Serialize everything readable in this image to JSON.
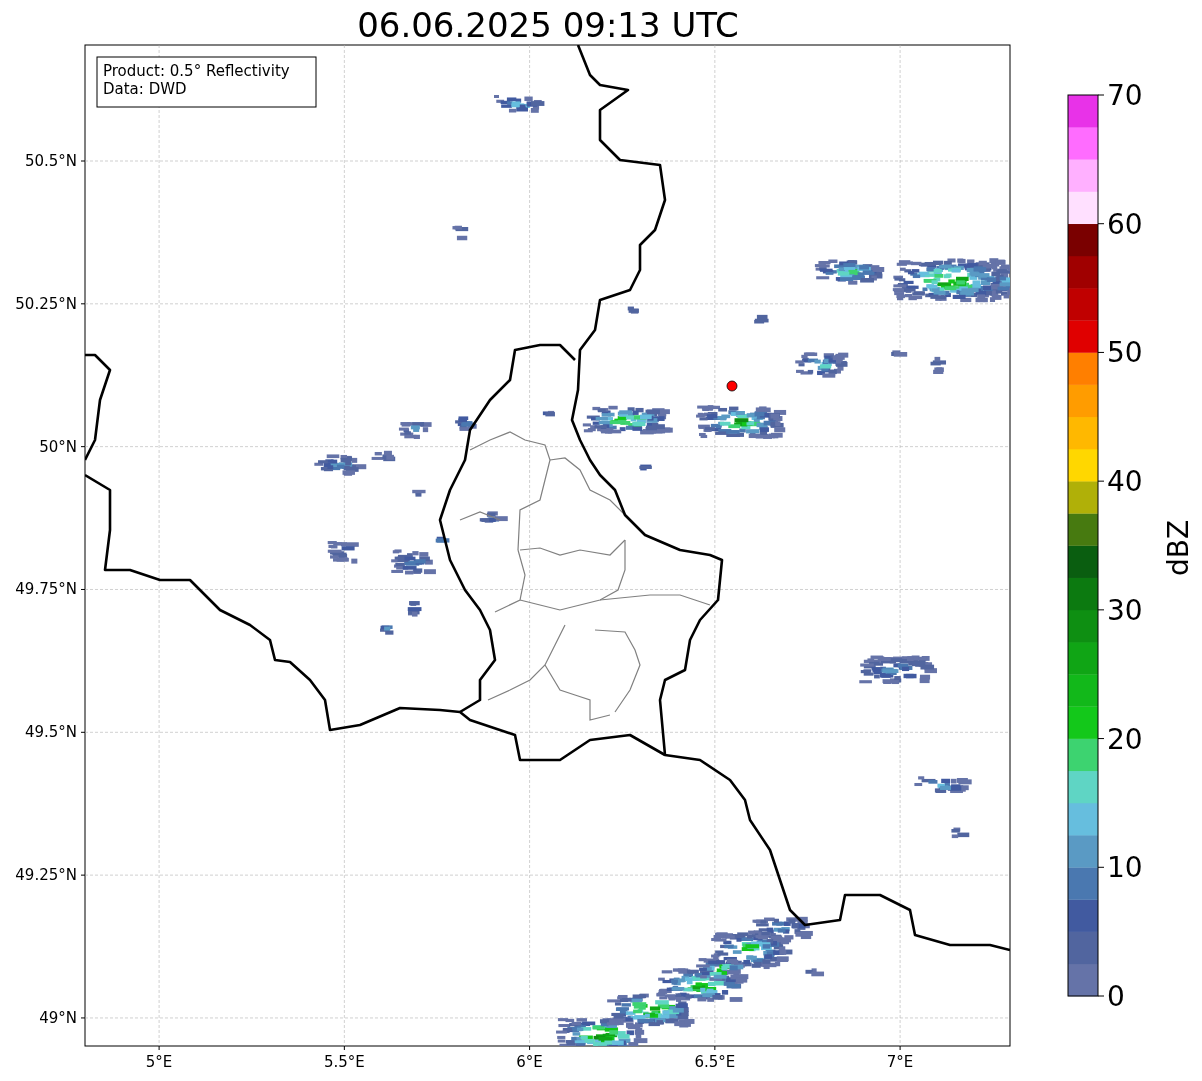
{
  "title": "06.06.2025 09:13 UTC",
  "legend": [
    "Product: 0.5° Reflectivity",
    "Data: DWD"
  ],
  "map": {
    "lon_ticks": [
      "5°E",
      "5.5°E",
      "6°E",
      "6.5°E",
      "7°E"
    ],
    "lat_ticks": [
      "50.5°N",
      "50.25°N",
      "50°N",
      "49.75°N",
      "49.5°N",
      "49.25°N",
      "49°N"
    ]
  },
  "colorbar": {
    "label": "dBZ",
    "ticks": [
      "70",
      "60",
      "50",
      "40",
      "30",
      "20",
      "10",
      "0"
    ],
    "bins": [
      {
        "color": "#6573a8"
      },
      {
        "color": "#51659f"
      },
      {
        "color": "#415aa0"
      },
      {
        "color": "#4a78b0"
      },
      {
        "color": "#5a9ac4"
      },
      {
        "color": "#66bede"
      },
      {
        "color": "#5fd5c4"
      },
      {
        "color": "#3dd370"
      },
      {
        "color": "#13c81a"
      },
      {
        "color": "#12b81a"
      },
      {
        "color": "#10a515"
      },
      {
        "color": "#0e8f12"
      },
      {
        "color": "#0c7a10"
      },
      {
        "color": "#0a5e10"
      },
      {
        "color": "#477a10"
      },
      {
        "color": "#b0b008"
      },
      {
        "color": "#ffd700"
      },
      {
        "color": "#ffb800"
      },
      {
        "color": "#ff9c00"
      },
      {
        "color": "#ff7f00"
      },
      {
        "color": "#e00000"
      },
      {
        "color": "#c00000"
      },
      {
        "color": "#a00000"
      },
      {
        "color": "#7a0000"
      },
      {
        "color": "#ffe0ff"
      },
      {
        "color": "#ffb0ff"
      },
      {
        "color": "#ff6cff"
      },
      {
        "color": "#e832e8"
      }
    ]
  }
}
